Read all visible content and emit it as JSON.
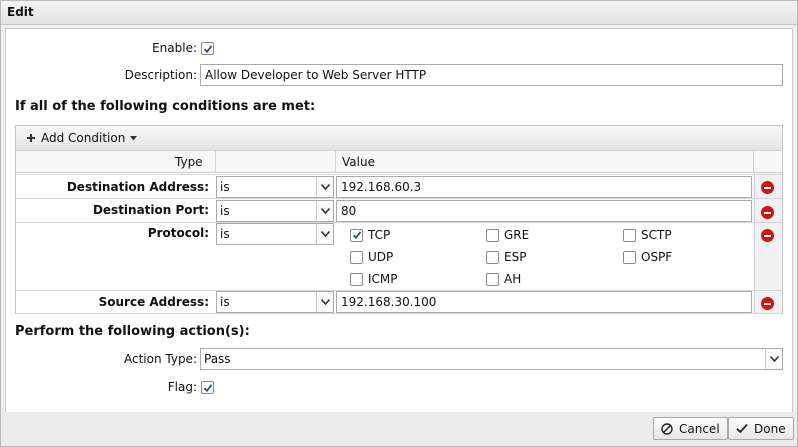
{
  "window": {
    "title": "Edit"
  },
  "form": {
    "enable_label": "Enable:",
    "enable_checked": true,
    "description_label": "Description:",
    "description_value": "Allow Developer to Web Server HTTP"
  },
  "conditions": {
    "title": "If all of the following conditions are met:",
    "add_label": "Add Condition",
    "col_type": "Type",
    "col_value": "Value",
    "rows": [
      {
        "label": "Destination Address:",
        "op": "is",
        "value": "192.168.60.3"
      },
      {
        "label": "Destination Port:",
        "op": "is",
        "value": "80"
      },
      {
        "label": "Protocol:",
        "op": "is"
      },
      {
        "label": "Source Address:",
        "op": "is",
        "value": "192.168.30.100"
      }
    ],
    "protocols": [
      {
        "name": "TCP",
        "checked": true
      },
      {
        "name": "GRE",
        "checked": false
      },
      {
        "name": "SCTP",
        "checked": false
      },
      {
        "name": "UDP",
        "checked": false
      },
      {
        "name": "ESP",
        "checked": false
      },
      {
        "name": "OSPF",
        "checked": false
      },
      {
        "name": "ICMP",
        "checked": false
      },
      {
        "name": "AH",
        "checked": false
      }
    ]
  },
  "actions": {
    "title": "Perform the following action(s):",
    "type_label": "Action Type:",
    "type_value": "Pass",
    "flag_label": "Flag:",
    "flag_checked": true
  },
  "buttons": {
    "cancel": "Cancel",
    "done": "Done"
  },
  "colors": {
    "remove": "#d21313",
    "check": "#2b4f8a"
  }
}
